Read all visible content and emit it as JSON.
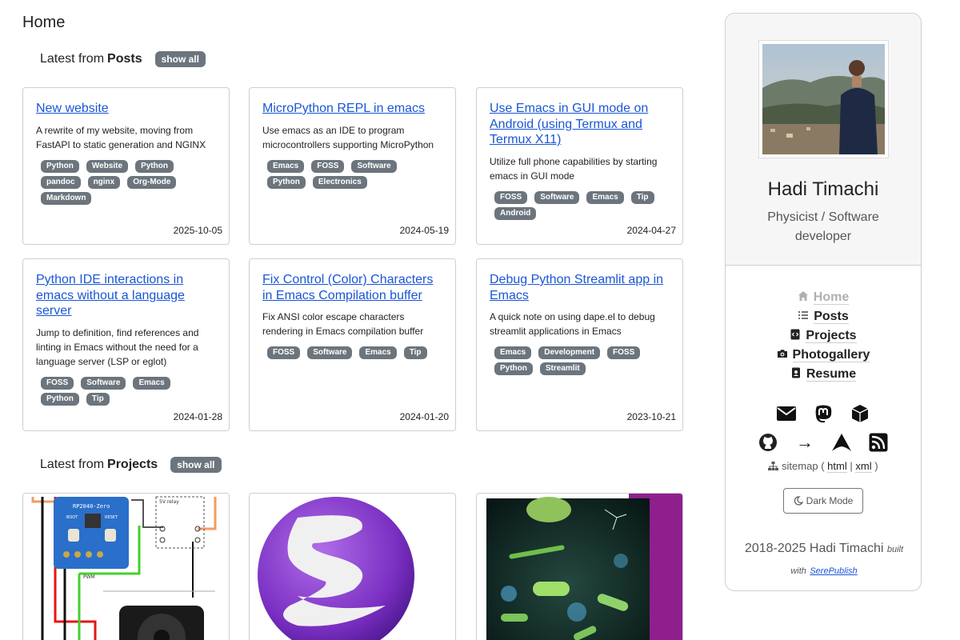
{
  "page": {
    "title": "Home"
  },
  "posts_section": {
    "prefix": "Latest from",
    "name": "Posts",
    "show_all": "show all"
  },
  "posts": [
    {
      "title": "New website",
      "desc": "A rewrite of my website, moving from FastAPI to static generation and NGINX",
      "tags": [
        "Python",
        "Website",
        "Python",
        "pandoc",
        "nginx",
        "Org-Mode",
        "Markdown"
      ],
      "date": "2025-10-05"
    },
    {
      "title": "MicroPython REPL in emacs",
      "desc": "Use emacs as an IDE to program microcontrollers supporting MicroPython",
      "tags": [
        "Emacs",
        "FOSS",
        "Software",
        "Python",
        "Electronics"
      ],
      "date": "2024-05-19"
    },
    {
      "title": "Use Emacs in GUI mode on Android (using Termux and Termux X11)",
      "desc": "Utilize full phone capabilities by starting emacs in GUI mode",
      "tags": [
        "FOSS",
        "Software",
        "Emacs",
        "Tip",
        "Android"
      ],
      "date": "2024-04-27"
    },
    {
      "title": "Python IDE interactions in emacs without a language server",
      "desc": "Jump to definition, find references and linting in Emacs without the need for a language server (LSP or eglot)",
      "tags": [
        "FOSS",
        "Software",
        "Emacs",
        "Python",
        "Tip"
      ],
      "date": "2024-01-28"
    },
    {
      "title": "Fix Control (Color) Characters in Emacs Compilation buffer",
      "desc": "Fix ANSI color escape characters rendering in Emacs compilation buffer",
      "tags": [
        "FOSS",
        "Software",
        "Emacs",
        "Tip"
      ],
      "date": "2024-01-20"
    },
    {
      "title": "Debug Python Streamlit app in Emacs",
      "desc": "A quick note on using dape.el to debug streamlit applications in Emacs",
      "tags": [
        "Emacs",
        "Development",
        "FOSS",
        "Python",
        "Streamlit"
      ],
      "date": "2023-10-21"
    }
  ],
  "projects_section": {
    "prefix": "Latest from",
    "name": "Projects",
    "show_all": "show all"
  },
  "project_images": [
    {
      "labels": [
        "RP2040-Zero",
        "BOOT",
        "RESET",
        "5V relay",
        "PWM"
      ]
    },
    {},
    {}
  ],
  "sidebar": {
    "name": "Hadi Timachi",
    "subtitle": "Physicist / Software developer",
    "nav": [
      {
        "label": "Home",
        "icon": "home-icon",
        "active": true
      },
      {
        "label": "Posts",
        "icon": "list-icon",
        "active": false
      },
      {
        "label": "Projects",
        "icon": "code-file-icon",
        "active": false
      },
      {
        "label": "Photogallery",
        "icon": "camera-icon",
        "active": false
      },
      {
        "label": "Resume",
        "icon": "id-badge-icon",
        "active": false
      }
    ],
    "social_row1": [
      "envelope-icon",
      "mastodon-icon",
      "cube-icon"
    ],
    "social_row2": [
      "github-icon",
      "arrow-right-icon",
      "archlinux-icon",
      "rss-icon"
    ],
    "arrow_glyph": "→",
    "sitemap": {
      "label": "sitemap",
      "open": "(",
      "html": "html",
      "sep": "|",
      "xml": "xml",
      "close": ")"
    },
    "dark_mode": "Dark Mode",
    "copyright": "2018-2025 Hadi Timachi",
    "built_with": "built with",
    "builder": "SerePublish"
  }
}
